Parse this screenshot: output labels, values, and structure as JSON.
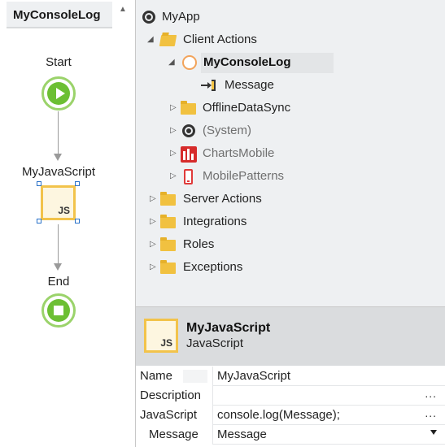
{
  "canvas": {
    "tab_title": "MyConsoleLog",
    "nodes": {
      "start": "Start",
      "js": "MyJavaScript",
      "js_badge": "JS",
      "end": "End"
    }
  },
  "tree": {
    "root": "MyApp",
    "items": [
      {
        "label": "Client Actions",
        "icon": "folder-open-icon"
      },
      {
        "label": "MyConsoleLog",
        "icon": "client-action-icon"
      },
      {
        "label": "Message",
        "icon": "input-parameter-icon"
      },
      {
        "label": "OfflineDataSync",
        "icon": "folder-icon"
      },
      {
        "label": "(System)",
        "icon": "system-module-icon"
      },
      {
        "label": "ChartsMobile",
        "icon": "charts-icon"
      },
      {
        "label": "MobilePatterns",
        "icon": "mobile-icon"
      },
      {
        "label": "Server Actions",
        "icon": "folder-icon"
      },
      {
        "label": "Integrations",
        "icon": "folder-icon"
      },
      {
        "label": "Roles",
        "icon": "folder-icon"
      },
      {
        "label": "Exceptions",
        "icon": "folder-icon"
      }
    ]
  },
  "properties": {
    "name": "MyJavaScript",
    "type": "JavaScript",
    "badge": "JS",
    "rows": [
      {
        "key": "Name",
        "value": "MyJavaScript"
      },
      {
        "key": "Description",
        "value": "",
        "more": "..."
      },
      {
        "key": "JavaScript",
        "value": "console.log(Message);",
        "more": "..."
      },
      {
        "key": "Message",
        "value": "Message"
      }
    ]
  },
  "colors": {
    "flow_green": "#6cbf33",
    "js_yellow": "#f2c34b",
    "folder": "#f1c140",
    "selection": "#2a72c9"
  }
}
